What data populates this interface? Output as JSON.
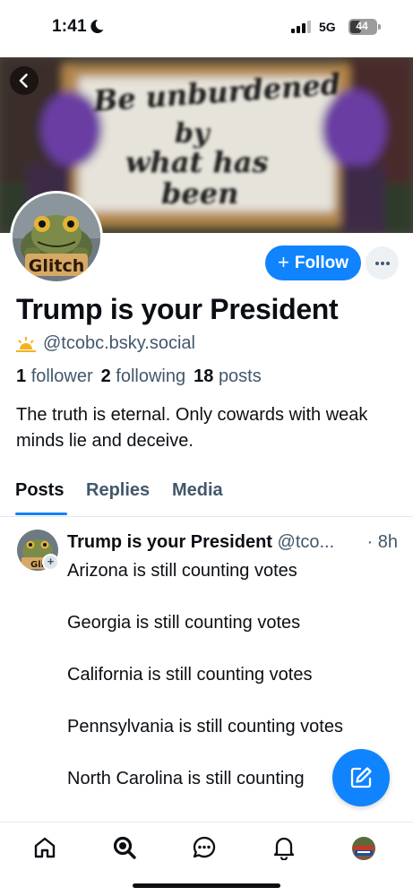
{
  "status_bar": {
    "time": "1:41",
    "network": "5G",
    "battery_percent": 44,
    "battery_label": "44"
  },
  "banner": {
    "sign_text": "Be unburdened by what has been"
  },
  "avatar": {
    "caption": "Glitch"
  },
  "actions": {
    "follow_label": "Follow",
    "more_label": "···"
  },
  "profile": {
    "display_name": "Trump is your President",
    "handle": "@tcobc.bsky.social",
    "followers_count": "1",
    "followers_label": "follower",
    "following_count": "2",
    "following_label": "following",
    "posts_count": "18",
    "posts_label": "posts",
    "bio": "The truth is eternal. Only cowards with weak minds lie and deceive."
  },
  "tabs": [
    {
      "label": "Posts",
      "active": true
    },
    {
      "label": "Replies",
      "active": false
    },
    {
      "label": "Media",
      "active": false
    }
  ],
  "post": {
    "author": "Trump is your President",
    "handle": "@tco...",
    "time": "· 8h",
    "lines": [
      "Arizona is still counting votes",
      "Georgia is still counting votes",
      "California is still counting votes",
      "Pennsylvania is still counting votes",
      "North Carolina is still counting"
    ]
  },
  "colors": {
    "accent": "#1083fe",
    "muted_text": "#42576c",
    "text": "#0b0f14"
  },
  "icons": {
    "back": "chevron-left-icon",
    "compose": "compose-icon",
    "nav": [
      "home-icon",
      "search-icon",
      "chat-icon",
      "notifications-icon",
      "profile-avatar"
    ]
  }
}
